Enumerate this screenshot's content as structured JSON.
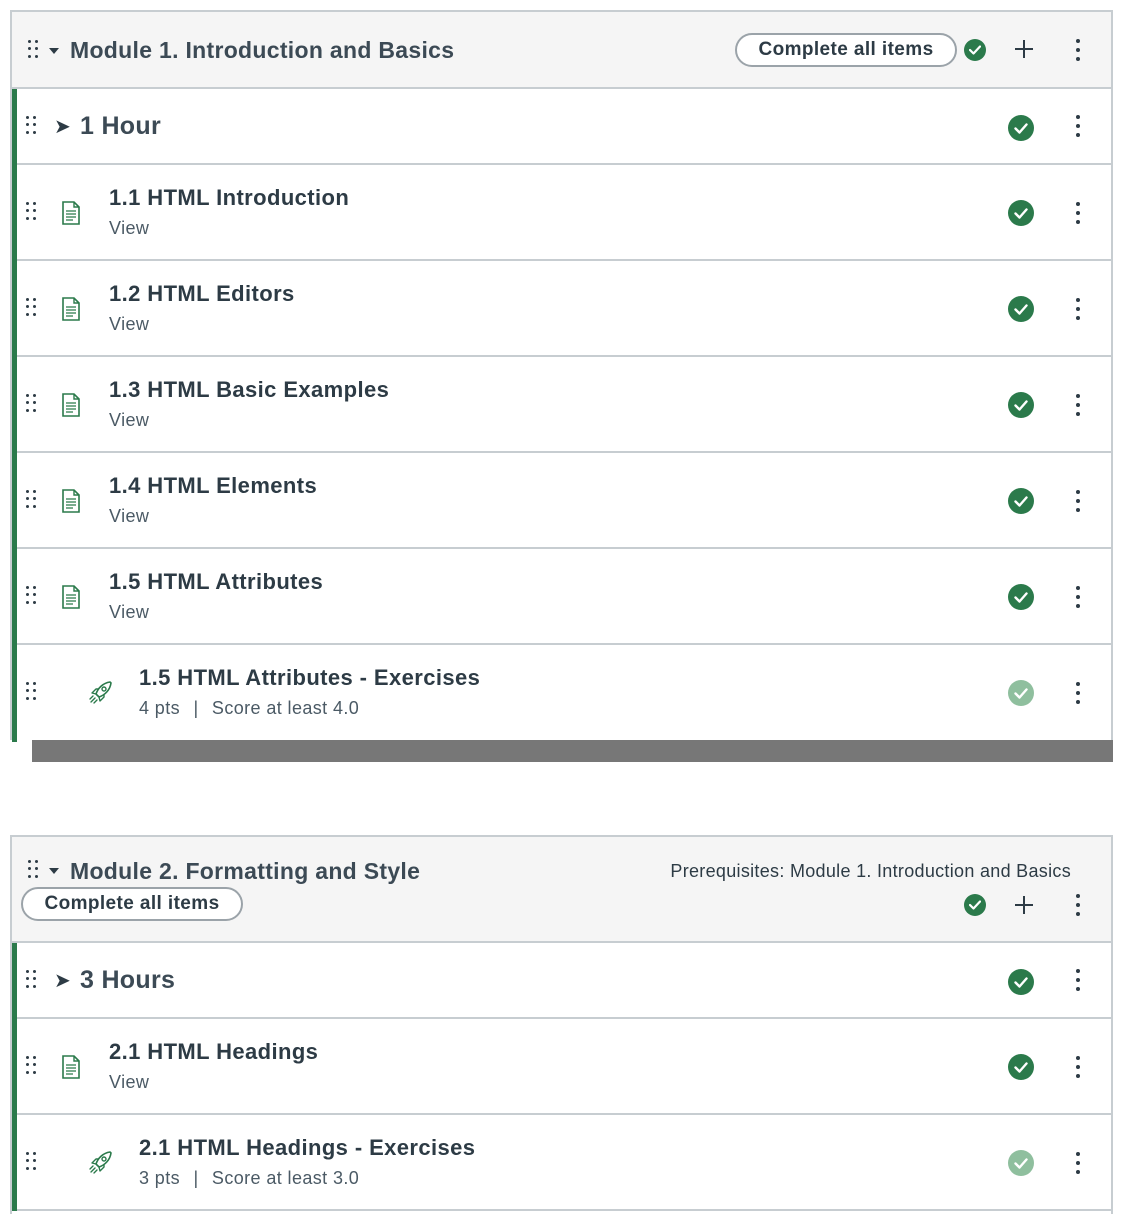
{
  "modules": [
    {
      "title": "Module 1. Introduction and Basics",
      "complete_all_label": "Complete all items",
      "subheader": {
        "title": "1 Hour"
      },
      "items": [
        {
          "title": "1.1 HTML Introduction",
          "subtitle": "View",
          "icon": "page-icon",
          "completed": true
        },
        {
          "title": "1.2 HTML Editors",
          "subtitle": "View",
          "icon": "page-icon",
          "completed": true
        },
        {
          "title": "1.3 HTML Basic Examples",
          "subtitle": "View",
          "icon": "page-icon",
          "completed": true
        },
        {
          "title": "1.4 HTML Elements",
          "subtitle": "View",
          "icon": "page-icon",
          "completed": true
        },
        {
          "title": "1.5 HTML Attributes",
          "subtitle": "View",
          "icon": "page-icon",
          "completed": true
        },
        {
          "title": "1.5 HTML Attributes - Exercises",
          "pts": "4 pts",
          "separator": "|",
          "requirement": "Score at least 4.0",
          "icon": "rocket-icon",
          "completed": false
        }
      ]
    },
    {
      "title": "Module 2. Formatting and Style",
      "prerequisites": "Prerequisites: Module 1. Introduction and Basics",
      "complete_all_label": "Complete all items",
      "subheader": {
        "title": "3 Hours"
      },
      "items": [
        {
          "title": "2.1 HTML Headings",
          "subtitle": "View",
          "icon": "page-icon",
          "completed": true
        },
        {
          "title": "2.1 HTML Headings - Exercises",
          "pts": "3 pts",
          "separator": "|",
          "requirement": "Score at least 3.0",
          "icon": "rocket-icon",
          "completed": false
        }
      ]
    }
  ],
  "icons": {
    "drag": "drag-handle-icon",
    "caret": "caret-down-icon",
    "arrow": "arrow-right-icon",
    "check": "checkmark-circle-icon",
    "plus": "plus-icon",
    "more": "kebab-menu-icon"
  },
  "colors": {
    "success": "#2b7a4b",
    "success_light": "#8fbf9e",
    "border": "#c7cdd1",
    "header_bg": "#f5f5f5",
    "scrollbar": "#777777"
  }
}
